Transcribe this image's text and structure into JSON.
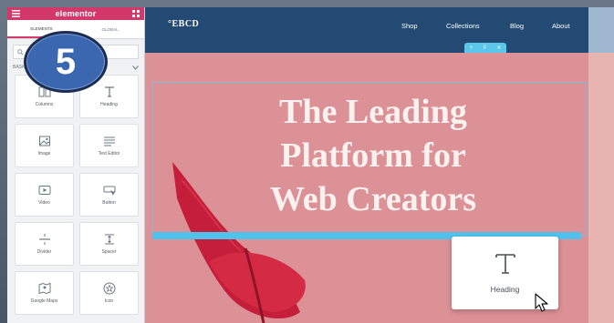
{
  "sidebar": {
    "logo": "elementor",
    "tabs": [
      "ELEMENTS",
      "GLOBAL"
    ],
    "section_label": "BASIC",
    "widgets": [
      {
        "label": "Columns",
        "icon": "columns-icon"
      },
      {
        "label": "Heading",
        "icon": "heading-icon"
      },
      {
        "label": "Image",
        "icon": "image-icon"
      },
      {
        "label": "Text Editor",
        "icon": "text-editor-icon"
      },
      {
        "label": "Video",
        "icon": "video-icon"
      },
      {
        "label": "Button",
        "icon": "button-icon"
      },
      {
        "label": "Divider",
        "icon": "divider-icon"
      },
      {
        "label": "Spacer",
        "icon": "spacer-icon"
      },
      {
        "label": "Google Maps",
        "icon": "map-icon"
      },
      {
        "label": "Icon",
        "icon": "star-icon"
      }
    ]
  },
  "badge": {
    "number": "5"
  },
  "site": {
    "brand": "°EBCD",
    "nav": [
      "Shop",
      "Collections",
      "Blog",
      "About"
    ],
    "section_handle": [
      "+",
      "⠿",
      "✕"
    ],
    "hero_title": [
      "The Leading",
      "Platform for",
      "Web Creators"
    ]
  },
  "drag_widget": {
    "label": "Heading",
    "icon": "heading-icon"
  },
  "colors": {
    "elementor_pink": "#d3386a",
    "nav_blue": "#224a72",
    "hero_pink": "#db9196",
    "drop_indicator": "#4fc3ee",
    "badge_blue": "#3b66b0"
  }
}
